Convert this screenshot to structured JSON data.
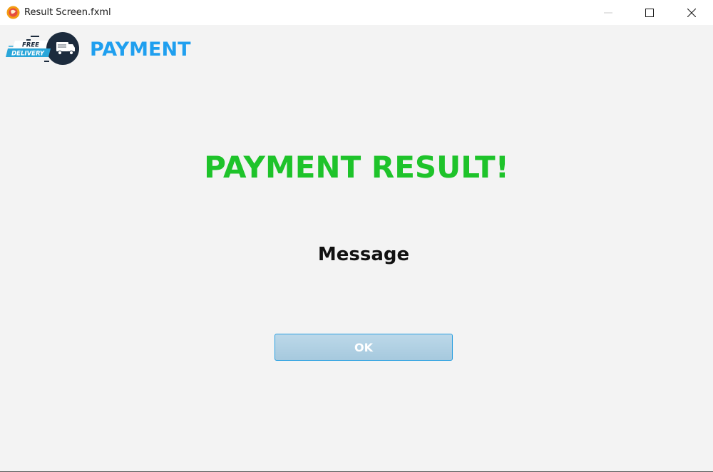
{
  "window": {
    "title": "Result Screen.fxml",
    "controls": {
      "minimize_icon": "minimize-icon",
      "maximize_icon": "maximize-icon",
      "close_icon": "close-icon"
    }
  },
  "header": {
    "logo_text_line1": "FREE",
    "logo_text_line2": "DELIVERY",
    "title": "PAYMENT"
  },
  "main": {
    "result_title": "PAYMENT RESULT!",
    "message": "Message",
    "ok_label": "OK"
  },
  "colors": {
    "header_title": "#1f9fef",
    "result_title": "#1ec32a",
    "button_border": "#2a9fe0",
    "background": "#f3f3f3"
  }
}
